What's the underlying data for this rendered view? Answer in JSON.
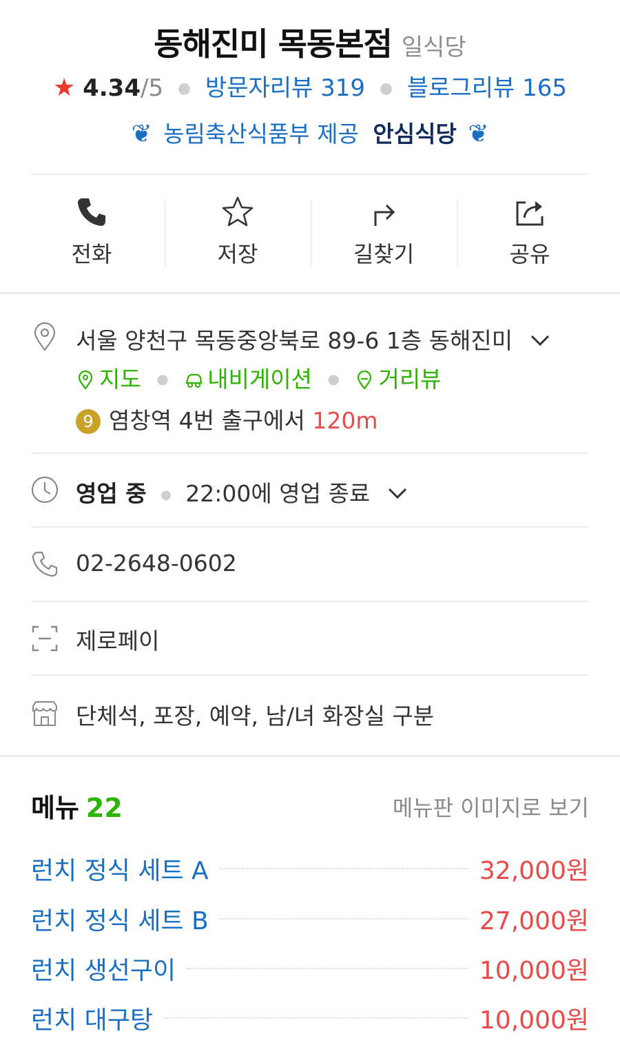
{
  "header": {
    "place_name": "동해진미 목동본점",
    "category": "일식당",
    "rating_value": "4.34",
    "rating_max": "/5",
    "visitor_review_label": "방문자리뷰 319",
    "blog_review_label": "블로그리뷰 165",
    "badge_prefix": "농림축산식품부 제공",
    "badge_strong": "안심식당"
  },
  "actions": [
    {
      "label": "전화",
      "icon": "phone-icon"
    },
    {
      "label": "저장",
      "icon": "star-outline-icon"
    },
    {
      "label": "길찾기",
      "icon": "directions-icon"
    },
    {
      "label": "공유",
      "icon": "share-icon"
    }
  ],
  "address": {
    "text": "서울 양천구 목동중앙북로 89-6 1층 동해진미",
    "links": [
      "지도",
      "내비게이션",
      "거리뷰"
    ],
    "subway_line": "9",
    "subway_station": "염창역",
    "subway_exit": " 4번 출구에서 ",
    "subway_distance": "120m"
  },
  "hours": {
    "status": "영업 중",
    "detail": "22:00에 영업 종료"
  },
  "phone": {
    "number": "02-2648-0602"
  },
  "payment": {
    "text": "제로페이"
  },
  "facilities": {
    "text": "단체석, 포장, 예약, 남/녀 화장실 구분"
  },
  "menu": {
    "title": "메뉴",
    "count": "22",
    "board_link": "메뉴판 이미지로 보기",
    "items": [
      {
        "name": "런치 정식 세트 A",
        "price": "32,000원"
      },
      {
        "name": "런치 정식 세트 B",
        "price": "27,000원"
      },
      {
        "name": "런치 생선구이",
        "price": "10,000원"
      },
      {
        "name": "런치 대구탕",
        "price": "10,000원"
      }
    ]
  },
  "colors": {
    "link_blue": "#1a6ec3",
    "naver_green": "#2db400",
    "price_red": "#e94a4a",
    "star_red": "#f0362d",
    "line9_gold": "#c9a227"
  }
}
